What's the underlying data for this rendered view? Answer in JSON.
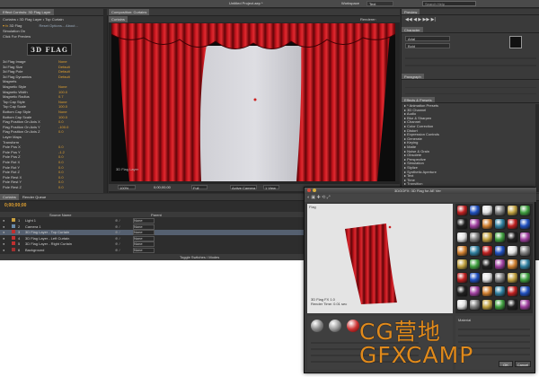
{
  "menubar": {
    "title": "Untitled Project.aep *",
    "workspace_label": "Workspace",
    "workspace_value": "Text",
    "search": "Search Help"
  },
  "effect_controls": {
    "tab": "Effect Controls: 3D Flag Layer",
    "breadcrumb": "Curtains • 3D Flag Layer • Top Curtain",
    "effect": "3D Flag",
    "options": "Reset  Options...  About...",
    "logo": "3D FLAG",
    "rows": [
      {
        "label": "Simulation On",
        "value": ""
      },
      {
        "label": "Click For Preview",
        "value": ""
      },
      {
        "label": "3d Flag Image",
        "value": "None"
      },
      {
        "label": "3d Flag Size",
        "value": "Default"
      },
      {
        "label": "3d Flag Pole",
        "value": "Default"
      },
      {
        "label": "3d Flag Dynamics",
        "value": "Default"
      },
      {
        "label": "Magnets",
        "value": ""
      },
      {
        "label": "Magnetic Style",
        "value": "None"
      },
      {
        "label": "Magnetic Width",
        "value": "100.0"
      },
      {
        "label": "Magnetic Radius",
        "value": "0.7"
      },
      {
        "label": "Top Cap Style",
        "value": "None"
      },
      {
        "label": "Top Cap Scale",
        "value": "100.0"
      },
      {
        "label": "Bottom Cap Style",
        "value": "None"
      },
      {
        "label": "Bottom Cap Scale",
        "value": "100.0"
      },
      {
        "label": "Flag Position On Axis X",
        "value": "0.0"
      },
      {
        "label": "Flag Position On Axis Y",
        "value": "-100.0"
      },
      {
        "label": "Flag Position On Axis Z",
        "value": "0.0"
      },
      {
        "label": "Layer Maps",
        "value": ""
      },
      {
        "label": "Transform",
        "value": ""
      },
      {
        "label": "Pole Pos X",
        "value": "0.0"
      },
      {
        "label": "Pole Pos Y",
        "value": "-1.2"
      },
      {
        "label": "Pole Pos Z",
        "value": "0.0"
      },
      {
        "label": "Pole Rot X",
        "value": "0.0"
      },
      {
        "label": "Pole Rot Y",
        "value": "0.0"
      },
      {
        "label": "Pole Rot Z",
        "value": "0.0"
      },
      {
        "label": "Pole Rest X",
        "value": "0.0"
      },
      {
        "label": "Pole Rest Y",
        "value": "0.0"
      },
      {
        "label": "Pole Rest Z",
        "value": "0.0"
      }
    ]
  },
  "composition": {
    "tab": "Composition: Curtains",
    "subtab": "Curtains",
    "renderer": "Renderer:",
    "camera": "Active Camera",
    "viewer_label": "Active Camera",
    "zoom": "100%",
    "timecode": "0;00;00;00",
    "quality": "Full",
    "view": "1 View",
    "footer_text": "3D Flag Layer"
  },
  "right_panel": {
    "preview_title": "Preview",
    "character_title": "Character",
    "font": "Arial",
    "font_style": "Bold",
    "paragraph_title": "Paragraph",
    "effects_title": "Effects & Presets",
    "effects": [
      "* Animation Presets",
      "3D Channel",
      "Audio",
      "Blur & Sharpen",
      "Channel",
      "Color Correction",
      "Distort",
      "Expression Controls",
      "Generate",
      "Keying",
      "Matte",
      "Noise & Grain",
      "Obsolete",
      "Perspective",
      "Simulation",
      "Stylize",
      "Synthetic Aperture",
      "Text",
      "Time",
      "Transition",
      "Utility"
    ]
  },
  "timeline": {
    "tab": "Curtains",
    "tab2": "Render Queue",
    "timecode": "0;00;00;00",
    "column_source": "Source Name",
    "column_parent": "Parent",
    "layers": [
      {
        "num": "1",
        "name": "Light 1",
        "color": "#c8a040",
        "selected": false
      },
      {
        "num": "2",
        "name": "Camera 1",
        "color": "#6a8aa8",
        "selected": false
      },
      {
        "num": "3",
        "name": "3D Flag Layer - Top Curtain",
        "color": "#c03030",
        "selected": true
      },
      {
        "num": "4",
        "name": "3D Flag Layer - Left Curtain",
        "color": "#c03030",
        "selected": false
      },
      {
        "num": "5",
        "name": "3D Flag Layer - Right Curtain",
        "color": "#c03030",
        "selected": false
      },
      {
        "num": "6",
        "name": "Background",
        "color": "#a03030",
        "selected": false
      }
    ],
    "parent_value": "None",
    "footer": "Toggle Switches / Modes"
  },
  "plugin_window": {
    "title": "3DGOFX: 3D Flag for AE Ver",
    "viewer_label": "Flag",
    "info_text": "3D Flag FX 1.0\nRender Time: 0.01 sec",
    "material_label": "Material",
    "ok": "OK",
    "cancel": "Cancel"
  },
  "watermark": {
    "line1": "CG营地",
    "line2": "GFXCAMP"
  },
  "colors": {
    "curtain": "#b0141c",
    "panel": "#3c3c3c",
    "accent": "#e08a1c"
  }
}
